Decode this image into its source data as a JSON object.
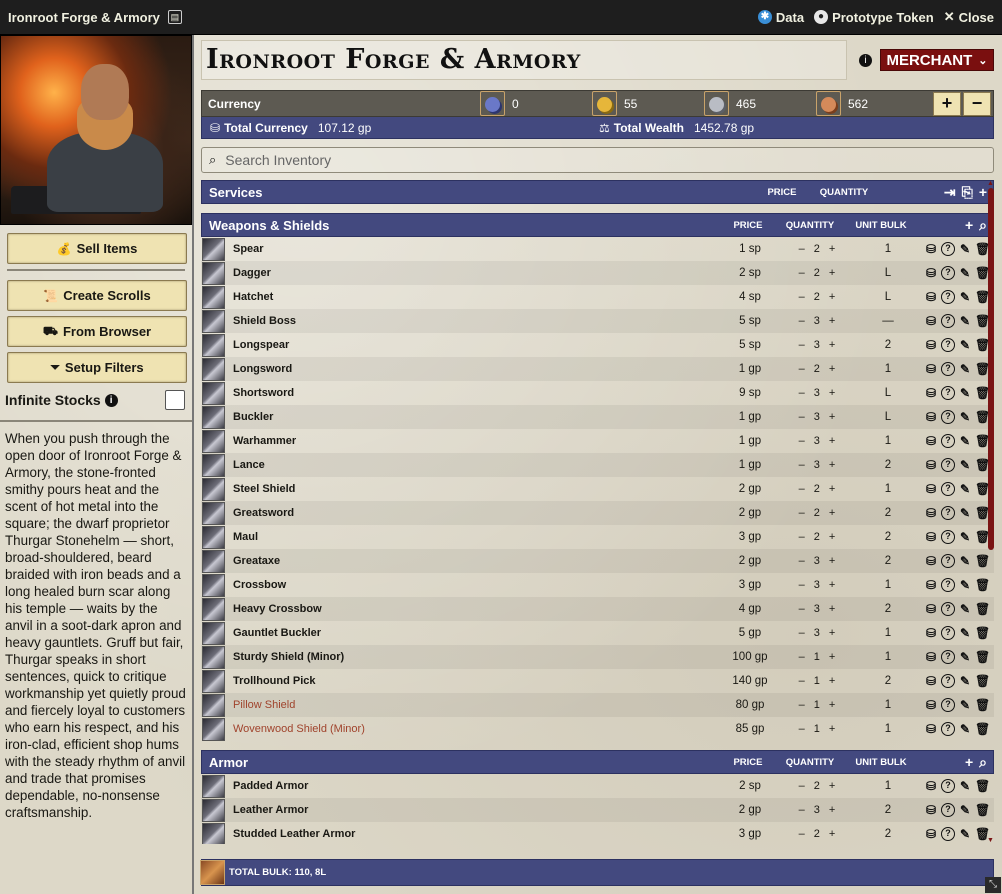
{
  "window": {
    "title": "Ironroot Forge & Armory",
    "data_label": "Data",
    "prototype_label": "Prototype Token",
    "close_label": "Close"
  },
  "actor": {
    "name": "Ironroot Forge & Armory",
    "sheet_type": "MERCHANT"
  },
  "sidebar": {
    "sell_items": "Sell Items",
    "create_scrolls": "Create Scrolls",
    "from_browser": "From Browser",
    "setup_filters": "Setup Filters",
    "infinite_stocks_label": "Infinite Stocks",
    "infinite_stocks_checked": false,
    "description": "When you push through the open door of Ironroot Forge & Armory, the stone-fronted smithy pours heat and the scent of hot metal into the square; the dwarf proprietor Thurgar Stonehelm — short, broad-shouldered, beard braided with iron beads and a long healed burn scar along his temple — waits by the anvil in a soot-dark apron and heavy gauntlets. Gruff but fair, Thurgar speaks in short sentences, quick to critique workmanship yet quietly proud and fiercely loyal to customers who earn his respect, and his iron-clad, efficient shop hums with the steady rhythm of anvil and trade that promises dependable, no-nonsense craftsmanship."
  },
  "currency": {
    "label": "Currency",
    "coins": [
      {
        "value": "0",
        "color": "#6a78c8",
        "shade": "#2d356e"
      },
      {
        "value": "55",
        "color": "#e6b63a",
        "shade": "#8a6a12"
      },
      {
        "value": "465",
        "color": "#b9bcc4",
        "shade": "#5c5f66"
      },
      {
        "value": "562",
        "color": "#d58a5a",
        "shade": "#7a3e1c"
      }
    ],
    "add": "+",
    "remove": "−"
  },
  "totals": {
    "total_currency_label": "Total Currency",
    "total_currency_value": "107.12 gp",
    "total_wealth_label": "Total Wealth",
    "total_wealth_value": "1452.78 gp"
  },
  "search": {
    "placeholder": "Search Inventory"
  },
  "columns": {
    "price": "PRICE",
    "quantity": "QUANTITY",
    "unit_bulk": "UNIT BULK"
  },
  "sections": {
    "services": {
      "title": "Services"
    },
    "weapons": {
      "title": "Weapons & Shields",
      "items": [
        {
          "name": "Spear",
          "price": "1 sp",
          "qty": "2",
          "bulk": "1"
        },
        {
          "name": "Dagger",
          "price": "2 sp",
          "qty": "2",
          "bulk": "L"
        },
        {
          "name": "Hatchet",
          "price": "4 sp",
          "qty": "2",
          "bulk": "L"
        },
        {
          "name": "Shield Boss",
          "price": "5 sp",
          "qty": "3",
          "bulk": "—"
        },
        {
          "name": "Longspear",
          "price": "5 sp",
          "qty": "3",
          "bulk": "2"
        },
        {
          "name": "Longsword",
          "price": "1 gp",
          "qty": "2",
          "bulk": "1"
        },
        {
          "name": "Shortsword",
          "price": "9 sp",
          "qty": "3",
          "bulk": "L"
        },
        {
          "name": "Buckler",
          "price": "1 gp",
          "qty": "3",
          "bulk": "L"
        },
        {
          "name": "Warhammer",
          "price": "1 gp",
          "qty": "3",
          "bulk": "1"
        },
        {
          "name": "Lance",
          "price": "1 gp",
          "qty": "3",
          "bulk": "2"
        },
        {
          "name": "Steel Shield",
          "price": "2 gp",
          "qty": "2",
          "bulk": "1"
        },
        {
          "name": "Greatsword",
          "price": "2 gp",
          "qty": "2",
          "bulk": "2"
        },
        {
          "name": "Maul",
          "price": "3 gp",
          "qty": "2",
          "bulk": "2"
        },
        {
          "name": "Greataxe",
          "price": "2 gp",
          "qty": "3",
          "bulk": "2"
        },
        {
          "name": "Crossbow",
          "price": "3 gp",
          "qty": "3",
          "bulk": "1"
        },
        {
          "name": "Heavy Crossbow",
          "price": "4 gp",
          "qty": "3",
          "bulk": "2"
        },
        {
          "name": "Gauntlet Buckler",
          "price": "5 gp",
          "qty": "3",
          "bulk": "1"
        },
        {
          "name": "Sturdy Shield (Minor)",
          "price": "100 gp",
          "qty": "1",
          "bulk": "1"
        },
        {
          "name": "Trollhound Pick",
          "price": "140 gp",
          "qty": "1",
          "bulk": "2"
        },
        {
          "name": "Pillow Shield",
          "price": "80 gp",
          "qty": "1",
          "bulk": "1",
          "linked": true
        },
        {
          "name": "Wovenwood Shield (Minor)",
          "price": "85 gp",
          "qty": "1",
          "bulk": "1",
          "linked": true
        }
      ]
    },
    "armor": {
      "title": "Armor",
      "items": [
        {
          "name": "Padded Armor",
          "price": "2 sp",
          "qty": "2",
          "bulk": "1"
        },
        {
          "name": "Leather Armor",
          "price": "2 gp",
          "qty": "3",
          "bulk": "2"
        },
        {
          "name": "Studded Leather Armor",
          "price": "3 gp",
          "qty": "2",
          "bulk": "2"
        }
      ]
    }
  },
  "footer": {
    "total_bulk": "TOTAL BULK: 110, 8L"
  }
}
